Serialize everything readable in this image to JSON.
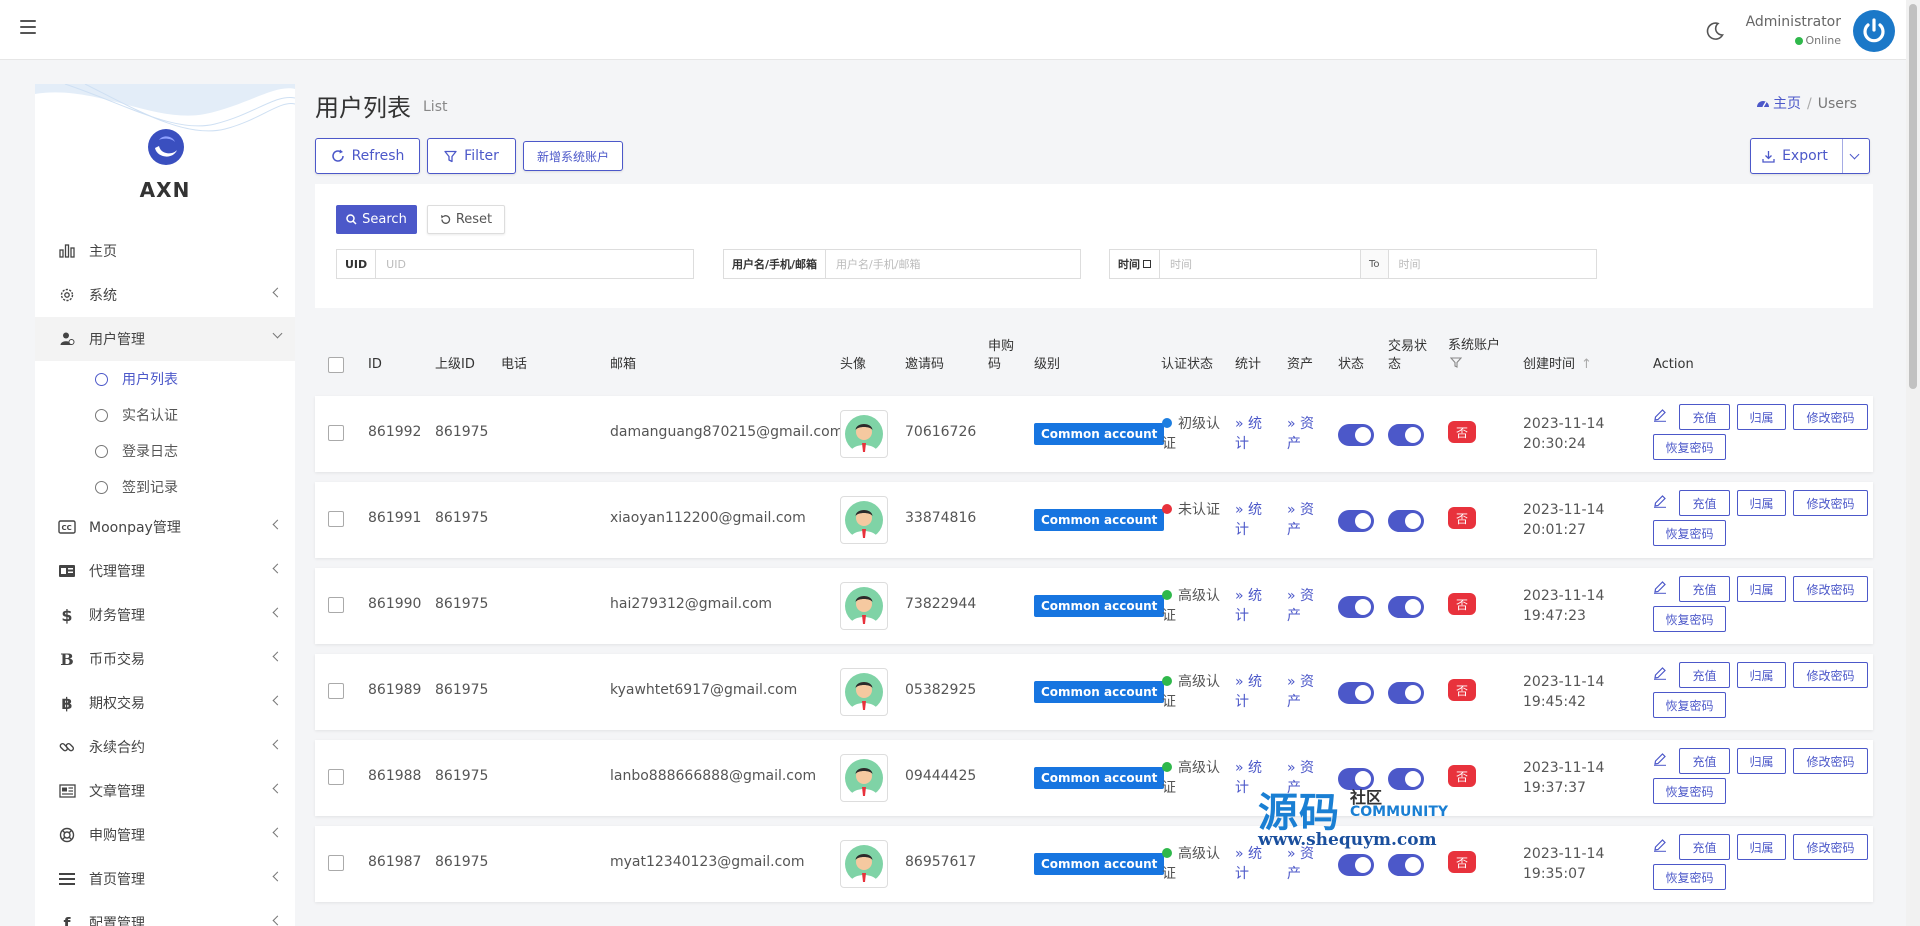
{
  "header": {
    "user_name": "Administrator",
    "user_status": "Online"
  },
  "sidebar": {
    "title": "AXN",
    "items": [
      {
        "label": "主页",
        "icon": "bar-chart-icon"
      },
      {
        "label": "系统",
        "icon": "gear-icon"
      },
      {
        "label": "用户管理",
        "icon": "users-icon"
      },
      {
        "label": "Moonpay管理",
        "icon": "cc-icon"
      },
      {
        "label": "代理管理",
        "icon": "id-card-icon"
      },
      {
        "label": "财务管理",
        "icon": "dollar-icon"
      },
      {
        "label": "币币交易",
        "icon": "bitcoin-b-icon"
      },
      {
        "label": "期权交易",
        "icon": "bitcoin-icon"
      },
      {
        "label": "永续合约",
        "icon": "link-icon"
      },
      {
        "label": "文章管理",
        "icon": "newspaper-icon"
      },
      {
        "label": "申购管理",
        "icon": "lifebuoy-icon"
      },
      {
        "label": "首页管理",
        "icon": "list-icon"
      },
      {
        "label": "配置管理",
        "icon": "wrench-icon"
      }
    ],
    "sub_items": [
      "用户列表",
      "实名认证",
      "登录日志",
      "签到记录"
    ]
  },
  "page": {
    "title": "用户列表",
    "subtitle": "List",
    "breadcrumb_home": "主页",
    "breadcrumb_current": "Users",
    "refresh": "Refresh",
    "filter": "Filter",
    "add_system": "新增系统账户",
    "export": "Export"
  },
  "search": {
    "search_btn": "Search",
    "reset_btn": "Reset",
    "uid_label": "UID",
    "uid_placeholder": "UID",
    "user_label": "用户名/手机/邮箱",
    "user_placeholder": "用户名/手机/邮箱",
    "time_label": "时间",
    "time_placeholder": "时间",
    "to": "To",
    "time_to_placeholder": "时间"
  },
  "table": {
    "headers": {
      "id": "ID",
      "parent": "上级ID",
      "phone": "电话",
      "email": "邮箱",
      "avatar": "头像",
      "invite": "邀请码",
      "subscribe": "申购码",
      "level": "级别",
      "auth": "认证状态",
      "stats": "统计",
      "assets": "资产",
      "status": "状态",
      "trade_status": "交易状态",
      "system_account": "系统账户",
      "created": "创建时间",
      "action": "Action"
    },
    "level_label": "Common account",
    "stats_link": "» 统计",
    "assets_link": "» 资产",
    "no_badge": "否",
    "actions": {
      "recharge": "充值",
      "belong": "归属",
      "change_pwd": "修改密码",
      "restore_pwd": "恢复密码"
    },
    "auth_colors": {
      "初级认证": "#1d7ee0",
      "未认证": "#e8323c",
      "高级认证": "#2fb84b"
    },
    "rows": [
      {
        "id": "861992",
        "parent": "861975",
        "email": "damanguang870215@gmail.com",
        "invite": "70616726",
        "auth": "初级认证",
        "date": "2023-11-14",
        "time": "20:30:24"
      },
      {
        "id": "861991",
        "parent": "861975",
        "email": "xiaoyan112200@gmail.com",
        "invite": "33874816",
        "auth": "未认证",
        "date": "2023-11-14",
        "time": "20:01:27"
      },
      {
        "id": "861990",
        "parent": "861975",
        "email": "hai279312@gmail.com",
        "invite": "73822944",
        "auth": "高级认证",
        "date": "2023-11-14",
        "time": "19:47:23"
      },
      {
        "id": "861989",
        "parent": "861975",
        "email": "kyawhtet6917@gmail.com",
        "invite": "05382925",
        "auth": "高级认证",
        "date": "2023-11-14",
        "time": "19:45:42"
      },
      {
        "id": "861988",
        "parent": "861975",
        "email": "lanbo888666888@gmail.com",
        "invite": "09444425",
        "auth": "高级认证",
        "date": "2023-11-14",
        "time": "19:37:37"
      },
      {
        "id": "861987",
        "parent": "861975",
        "email": "myat12340123@gmail.com",
        "invite": "86957617",
        "auth": "高级认证",
        "date": "2023-11-14",
        "time": "19:35:07"
      }
    ]
  },
  "watermark": {
    "big": "源码",
    "small1": "社区",
    "small2": "COMMUNITY",
    "url": "www.shequym.com"
  }
}
